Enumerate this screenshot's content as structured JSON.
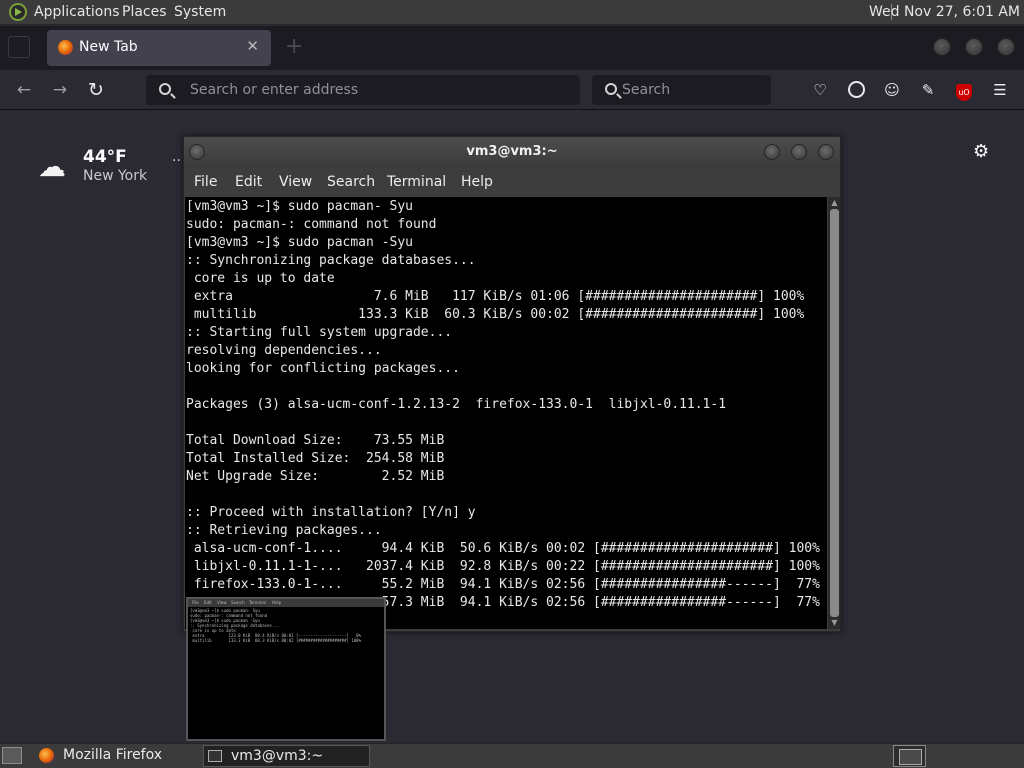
{
  "top_panel": {
    "menu": [
      "Applications",
      "Places",
      "System"
    ],
    "clock": "Wed Nov 27,  6:01 AM"
  },
  "firefox": {
    "tab": {
      "title": "New Tab",
      "close": "✕"
    },
    "new_tab": "+",
    "nav": {
      "back": "←",
      "forward": "→",
      "reload": "↻"
    },
    "address_placeholder": "Search or enter address",
    "search_placeholder": "Search",
    "toolbar_icons": [
      "pocket-icon",
      "circle-icon",
      "account-icon",
      "extensions-icon",
      "ublock-icon",
      "menu-icon"
    ],
    "weather": {
      "temp": "44°F",
      "city": "New York",
      "more": "··"
    }
  },
  "terminal": {
    "title": "vm3@vm3:~",
    "menu": [
      "File",
      "Edit",
      "View",
      "Search",
      "Terminal",
      "Help"
    ],
    "lines": [
      "[vm3@vm3 ~]$ sudo pacman- Syu",
      "sudo: pacman-: command not found",
      "[vm3@vm3 ~]$ sudo pacman -Syu",
      ":: Synchronizing package databases...",
      " core is up to date",
      " extra                  7.6 MiB   117 KiB/s 01:06 [######################] 100%",
      " multilib             133.3 KiB  60.3 KiB/s 00:02 [######################] 100%",
      ":: Starting full system upgrade...",
      "resolving dependencies...",
      "looking for conflicting packages...",
      "",
      "Packages (3) alsa-ucm-conf-1.2.13-2  firefox-133.0-1  libjxl-0.11.1-1",
      "",
      "Total Download Size:    73.55 MiB",
      "Total Installed Size:  254.58 MiB",
      "Net Upgrade Size:        2.52 MiB",
      "",
      ":: Proceed with installation? [Y/n] y",
      ":: Retrieving packages...",
      " alsa-ucm-conf-1....     94.4 KiB  50.6 KiB/s 00:02 [######################] 100%",
      " libjxl-0.11.1-1-...   2037.4 KiB  92.8 KiB/s 00:22 [######################] 100%",
      " firefox-133.0-1-...     55.2 MiB  94.1 KiB/s 02:56 [################------]  77%",
      "                         57.3 MiB  94.1 KiB/s 02:56 [################------]  77%"
    ]
  },
  "preview": {
    "menu": [
      "File",
      "Edit",
      "View",
      "Search",
      "Terminal",
      "Help"
    ],
    "lines": [
      "[vm3@vm3 ~]$ sudo pacman- Syu",
      "sudo: pacman-: command not found",
      "[vm3@vm3 ~]$ sudo pacman -Syu",
      ":: Synchronizing package databases...",
      " core is up to date",
      " extra          123.0 KiB  88.4 KiB/s 00:01 [--------------------]   0%",
      " multilib       133.3 KiB  60.3 KiB/s 00:02 [####################] 100%"
    ]
  },
  "taskbar": {
    "firefox": "Mozilla Firefox",
    "terminal": "vm3@vm3:~"
  }
}
